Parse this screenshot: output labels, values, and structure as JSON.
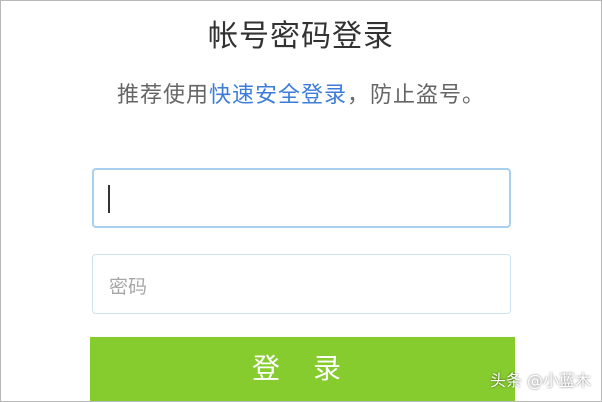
{
  "title": "帐号密码登录",
  "subtitle": {
    "prefix": "推荐使用",
    "link": "快速安全登录",
    "suffix": "，防止盗号。"
  },
  "account_input": {
    "value": "",
    "placeholder": ""
  },
  "password_input": {
    "placeholder": "密码"
  },
  "login_button": {
    "label": "登 录"
  },
  "watermark": "头条 @小蓝木",
  "colors": {
    "button": "#86cc2e",
    "link": "#3b7dd8",
    "focus_border": "#a9cfee"
  }
}
